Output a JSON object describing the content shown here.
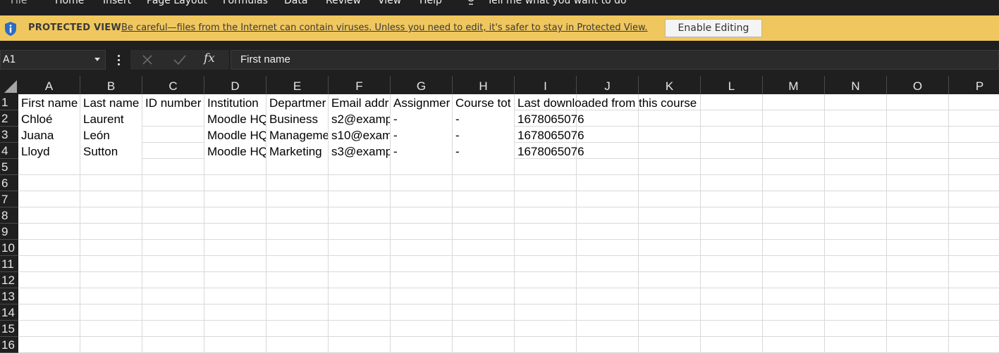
{
  "ribbon": {
    "tabs": [
      "File",
      "Home",
      "Insert",
      "Page Layout",
      "Formulas",
      "Data",
      "Review",
      "View",
      "Help"
    ],
    "tell_me": "Tell me what you want to do"
  },
  "protected_view": {
    "title": "PROTECTED VIEW",
    "message": "Be careful—files from the Internet can contain viruses. Unless you need to edit, it's safer to stay in Protected View.",
    "button": "Enable Editing",
    "bar_color": "#f0c75e"
  },
  "formula_bar": {
    "name_box": "A1",
    "formula": "First name"
  },
  "sheet": {
    "columns": [
      "A",
      "B",
      "C",
      "D",
      "E",
      "F",
      "G",
      "H",
      "I",
      "J",
      "K",
      "L",
      "M",
      "N",
      "O",
      "P"
    ],
    "rows": [
      "1",
      "2",
      "3",
      "4",
      "5",
      "6",
      "7",
      "8",
      "9",
      "10",
      "11",
      "12",
      "13",
      "14",
      "15",
      "16"
    ],
    "data": [
      [
        "First name",
        "Last name",
        "ID number",
        "Institution",
        "Departmer",
        "Email addr",
        "Assignmer",
        "Course tot",
        "Last downloaded from this course"
      ],
      [
        "Chloé",
        "Laurent",
        "",
        "Moodle HQ",
        "Business",
        "s2@examp",
        "-",
        "-",
        "1678065076"
      ],
      [
        "Juana",
        "León",
        "",
        "Moodle HQ",
        "Manageme",
        "s10@exam",
        "-",
        "-",
        "1678065076"
      ],
      [
        "Lloyd",
        "Sutton",
        "",
        "Moodle HQ",
        "Marketing",
        "s3@examp",
        "-",
        "-",
        "1678065076"
      ]
    ]
  }
}
